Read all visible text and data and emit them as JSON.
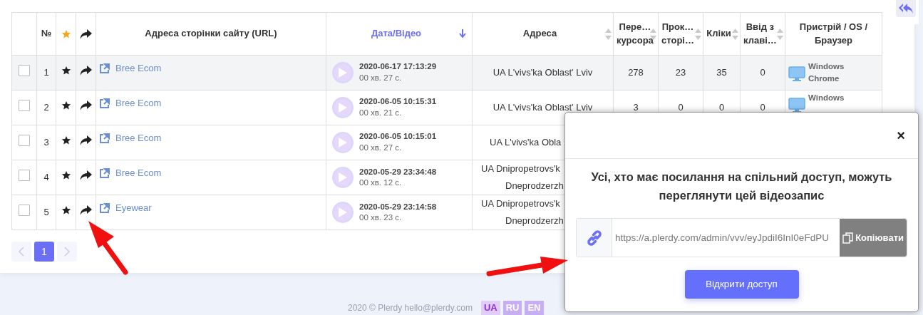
{
  "table": {
    "columns": [
      {
        "kind": "blank"
      },
      {
        "kind": "text",
        "lines": [
          "№"
        ],
        "selected": false
      },
      {
        "kind": "star"
      },
      {
        "kind": "share"
      },
      {
        "kind": "text",
        "lines": [
          "Адреса сторінки сайту (URL)"
        ],
        "selected": false
      },
      {
        "kind": "sortable",
        "lines": [
          "Дата/Відео"
        ],
        "selected": true
      },
      {
        "kind": "sortable",
        "lines": [
          "Адреса"
        ],
        "selected": false
      },
      {
        "kind": "sortable",
        "lines": [
          "Пере…",
          "курсора"
        ],
        "selected": false
      },
      {
        "kind": "sortable",
        "lines": [
          "Прок…",
          "сторі…"
        ],
        "selected": false
      },
      {
        "kind": "sortable",
        "lines": [
          "Кліки"
        ],
        "selected": false
      },
      {
        "kind": "sortable",
        "lines": [
          "Ввід з",
          "клаві…"
        ],
        "selected": false
      },
      {
        "kind": "text",
        "lines": [
          "Пристрій / OS /",
          "Браузер"
        ],
        "selected": false
      }
    ],
    "rows": [
      {
        "number": "1",
        "checked": false,
        "highlighted": true,
        "page": "Bree Ecom",
        "date": "2020-06-17 17:13:29",
        "duration": "00 хв. 27 с.",
        "address": [
          "UA L'vivs'ka Oblast' Lviv"
        ],
        "metrics": [
          "278",
          "23",
          "35",
          "0"
        ],
        "device": [
          "Windows",
          "Chrome"
        ]
      },
      {
        "number": "2",
        "checked": false,
        "highlighted": false,
        "page": "Bree Ecom",
        "date": "2020-06-05 10:15:31",
        "duration": "00 хв. 21 с.",
        "address": [
          "UA L'vivs'ka Oblast' Lviv"
        ],
        "metrics": [
          "3",
          "0",
          "0",
          "0"
        ],
        "device": [
          "Windows"
        ]
      },
      {
        "number": "3",
        "checked": false,
        "highlighted": false,
        "page": "Bree Ecom",
        "date": "2020-06-05 10:15:01",
        "duration": "00 хв. 27 с.",
        "address": [
          "UA L'vivs'ka Obla"
        ]
      },
      {
        "number": "4",
        "checked": false,
        "highlighted": false,
        "page": "Bree Ecom",
        "date": "2020-05-29 23:34:48",
        "duration": "00 хв. 12 с.",
        "address": [
          "UA Dnipropetrovs'k",
          "Dneprodzerzh"
        ]
      },
      {
        "number": "5",
        "checked": false,
        "highlighted": false,
        "page": "Eyewear",
        "date": "2020-05-29 23:14:58",
        "duration": "00 хв. 23 с.",
        "address": [
          "UA Dnipropetrovs'k",
          "Dneprodzerzh"
        ]
      }
    ]
  },
  "pagination": {
    "pages": [
      {
        "label": "1",
        "selected": true
      }
    ]
  },
  "footer": {
    "text": "2020 © Plerdy hello@plerdy.com",
    "languages": [
      {
        "label": "UA",
        "selected": true
      },
      {
        "label": "RU",
        "selected": false
      },
      {
        "label": "EN",
        "selected": false
      }
    ]
  },
  "modal": {
    "close_label": "×",
    "message": "Усі, хто має посилання на спільний доступ, можуть переглянути цей відеозапис",
    "link": "https://a.plerdy.com/admin/vvv/eyJpdiI6InI0eFdPU",
    "copy_button": "Копіювати",
    "share_button": "Відкрити доступ"
  }
}
